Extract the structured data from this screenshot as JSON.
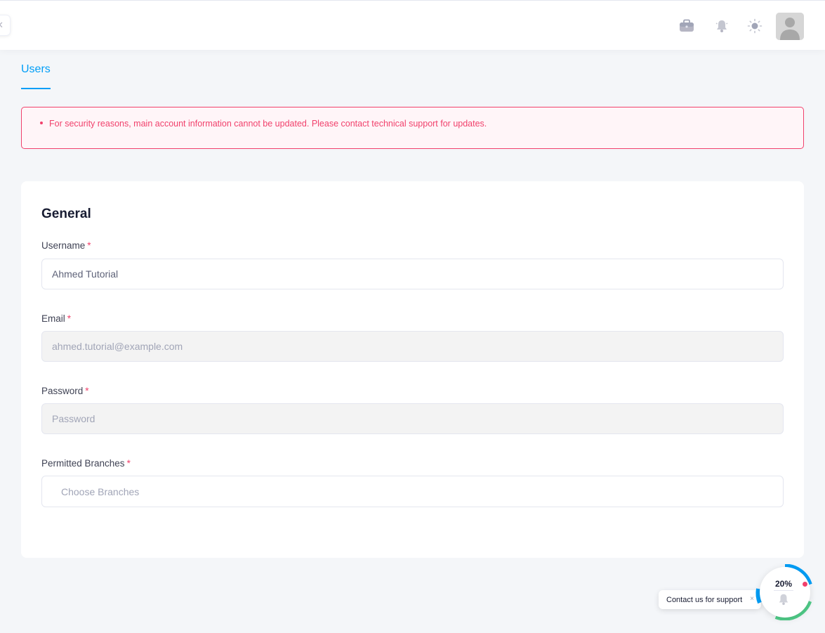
{
  "header": {
    "icons": [
      "collapse-icon",
      "briefcase-icon",
      "bell-icon",
      "sun-icon",
      "avatar"
    ]
  },
  "tabs": [
    {
      "label": "Users",
      "active": true
    }
  ],
  "alert": {
    "message": "For security reasons, main account information cannot be updated. Please contact technical support for updates."
  },
  "form": {
    "title": "General",
    "required_mark": "*",
    "fields": {
      "username": {
        "label": "Username",
        "value": "Ahmed Tutorial"
      },
      "email": {
        "label": "Email",
        "value": "ahmed.tutorial@example.com"
      },
      "password": {
        "label": "Password",
        "placeholder": "Password"
      },
      "branches": {
        "label": "Permitted Branches",
        "placeholder": "Choose Branches"
      }
    }
  },
  "support": {
    "label": "Contact us for support",
    "close": "×",
    "progress_text": "20%",
    "progress_fraction": 0.2
  },
  "colors": {
    "accent": "#009ef7",
    "danger": "#f1416c",
    "success": "#50cd89"
  }
}
